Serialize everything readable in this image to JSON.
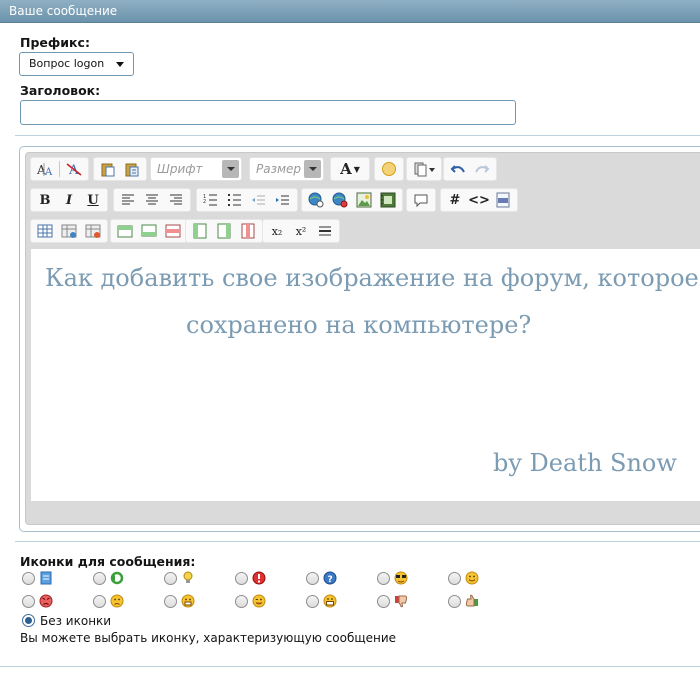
{
  "window": {
    "title": "Ваше сообщение"
  },
  "form": {
    "prefix_label": "Префикс:",
    "prefix_value": "Вопрос logon",
    "title_label": "Заголовок:",
    "title_value": ""
  },
  "toolbar": {
    "font_placeholder": "Шрифт",
    "size_placeholder": "Размер",
    "font_color_glyph": "A",
    "bold_glyph": "B",
    "italic_glyph": "I",
    "underline_glyph": "U",
    "hash_glyph": "#",
    "code_glyph": "<>",
    "sub_glyph": "x₂",
    "sup_glyph": "x²"
  },
  "editor": {
    "line1": "Как добавить свое изображение на форум, которое",
    "line2": "сохранено на компьютере?",
    "signature": "by Death Snow",
    "text_color": "#7b9bb3"
  },
  "icons": {
    "label": "Иконки для сообщения:",
    "items": [
      "document",
      "recycle",
      "lightbulb",
      "exclamation",
      "question",
      "cool",
      "smile",
      "angry",
      "sad",
      "surprised",
      "wink",
      "grin",
      "thumbs-down",
      "thumbs-up"
    ],
    "none_label": "Без иконки",
    "hint": "Вы можете выбрать иконку, характеризующую сообщение"
  }
}
